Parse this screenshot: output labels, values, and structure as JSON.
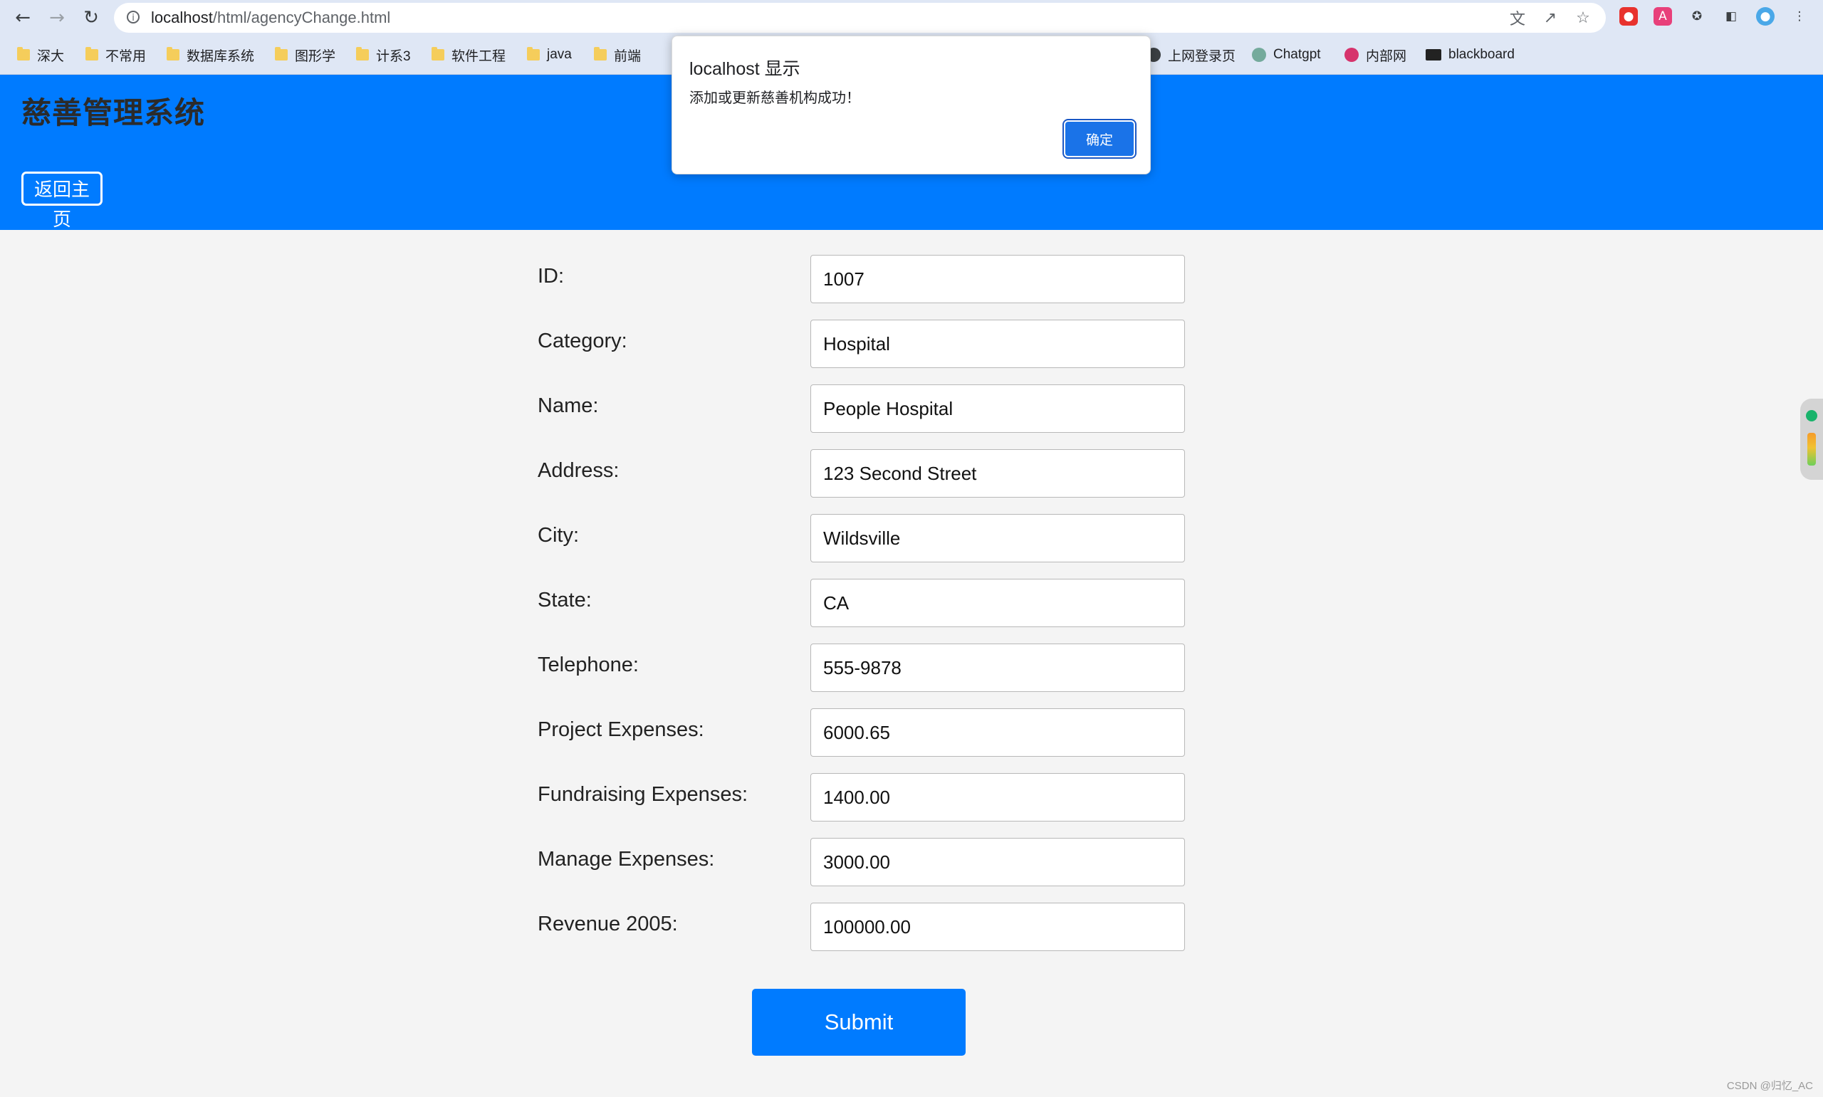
{
  "browser": {
    "url_host": "localhost",
    "url_path": "/html/agencyChange.html",
    "bookmarks": [
      {
        "label": "深大",
        "icon": "folder-icon"
      },
      {
        "label": "不常用",
        "icon": "folder-icon"
      },
      {
        "label": "数据库系统",
        "icon": "folder-icon"
      },
      {
        "label": "图形学",
        "icon": "folder-icon"
      },
      {
        "label": "计系3",
        "icon": "folder-icon"
      },
      {
        "label": "软件工程",
        "icon": "folder-icon"
      },
      {
        "label": "java",
        "icon": "folder-icon"
      },
      {
        "label": "前端",
        "icon": "folder-icon"
      },
      {
        "label": "上网登录页",
        "icon": "globe-icon"
      },
      {
        "label": "Chatgpt",
        "icon": "chatgpt-icon"
      },
      {
        "label": "内部网",
        "icon": "intranet-icon"
      },
      {
        "label": "blackboard",
        "icon": "blackboard-icon"
      }
    ],
    "colors": {
      "chrome": "#dfe7f5"
    }
  },
  "header": {
    "title": "慈善管理系统",
    "home_button": "返回主页",
    "background": "#007bff"
  },
  "form": {
    "fields": [
      {
        "label": "ID:",
        "value": "1007"
      },
      {
        "label": "Category:",
        "value": "Hospital"
      },
      {
        "label": "Name:",
        "value": "People Hospital"
      },
      {
        "label": "Address:",
        "value": "123 Second Street"
      },
      {
        "label": "City:",
        "value": "Wildsville"
      },
      {
        "label": "State:",
        "value": "CA"
      },
      {
        "label": "Telephone:",
        "value": "555-9878"
      },
      {
        "label": "Project Expenses:",
        "value": "6000.65"
      },
      {
        "label": "Fundraising Expenses:",
        "value": "1400.00"
      },
      {
        "label": "Manage Expenses:",
        "value": "3000.00"
      },
      {
        "label": "Revenue 2005:",
        "value": "100000.00"
      }
    ],
    "submit_label": "Submit"
  },
  "dialog": {
    "title": "localhost 显示",
    "message": "添加或更新慈善机构成功！",
    "ok_label": "确定"
  },
  "watermark": "CSDN @归忆_AC"
}
